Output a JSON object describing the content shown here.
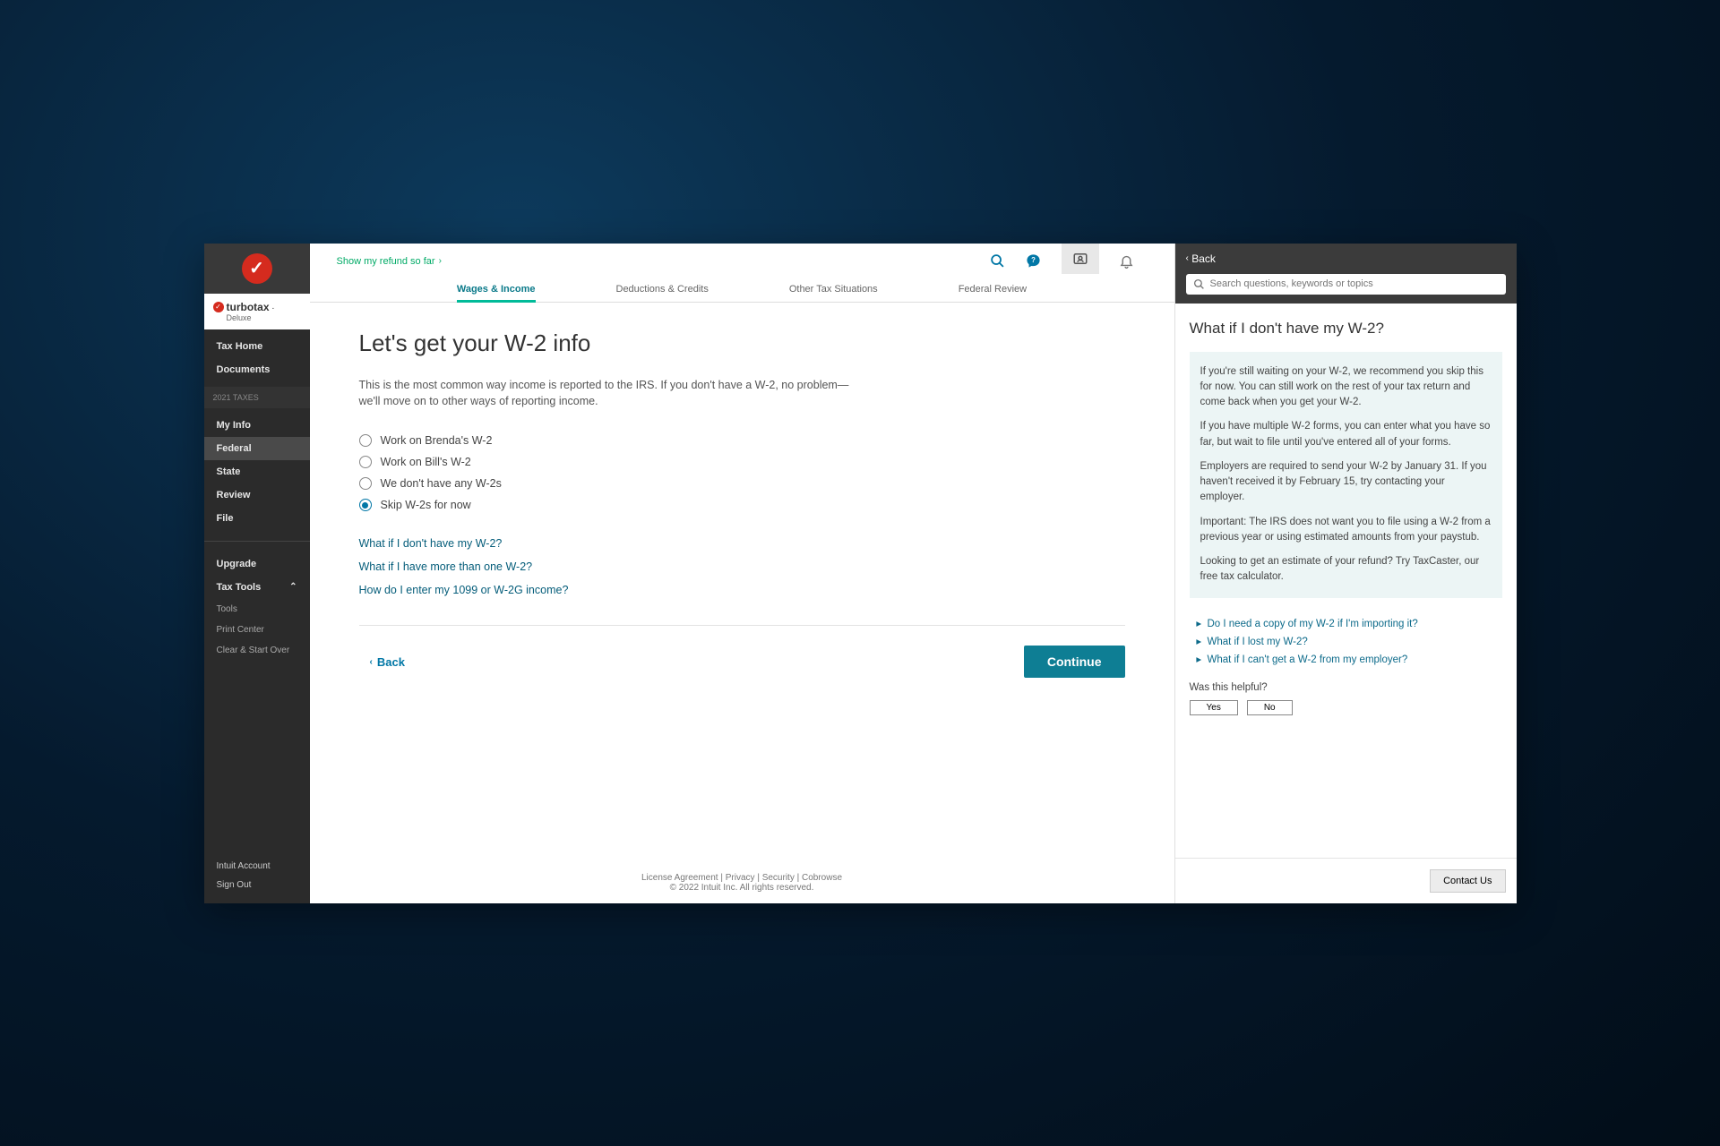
{
  "brand": {
    "name": "turbotax",
    "tier": "Deluxe"
  },
  "sidebar": {
    "items": [
      "Tax Home",
      "Documents"
    ],
    "taxes_header": "2021 TAXES",
    "tax_items": [
      "My Info",
      "Federal",
      "State",
      "Review",
      "File"
    ],
    "tools": {
      "upgrade": "Upgrade",
      "tax_tools": "Tax Tools",
      "subs": [
        "Tools",
        "Print Center",
        "Clear & Start Over"
      ]
    },
    "footer": {
      "account": "Intuit Account",
      "signout": "Sign Out"
    }
  },
  "topbar": {
    "refund_link": "Show my refund so far"
  },
  "tabs": [
    "Wages & Income",
    "Deductions & Credits",
    "Other Tax Situations",
    "Federal Review"
  ],
  "page": {
    "title": "Let's get your W-2 info",
    "desc": "This is the most common way income is reported to the IRS. If you don't have a W-2, no problem—we'll move on to other ways of reporting income.",
    "options": [
      "Work on Brenda's W-2",
      "Work on Bill's W-2",
      "We don't have any W-2s",
      "Skip W-2s for now"
    ],
    "selected_index": 3,
    "help_links": [
      "What if I don't have my W-2?",
      "What if I have more than one W-2?",
      "How do I enter my 1099 or W-2G income?"
    ],
    "back": "Back",
    "continue": "Continue"
  },
  "footer": {
    "links": [
      "License Agreement",
      "Privacy",
      "Security",
      "Cobrowse"
    ],
    "copyright": "© 2022 Intuit Inc. All rights reserved."
  },
  "help": {
    "back": "Back",
    "search_placeholder": "Search questions, keywords or topics",
    "title": "What if I don't have my W-2?",
    "paras": [
      "If you're still waiting on your W-2, we recommend you skip this for now. You can still work on the rest of your tax return and come back when you get your W-2.",
      "If you have multiple W-2 forms, you can enter what you have so far, but wait to file until you've entered all of your forms.",
      "Employers are required to send your W-2 by January 31. If you haven't received it by February 15, try contacting your employer.",
      "Important: The IRS does not want you to file using a W-2 from a previous year or using estimated amounts from your paystub.",
      "Looking to get an estimate of your refund? Try TaxCaster, our free tax calculator."
    ],
    "related": [
      "Do I need a copy of my W-2 if I'm importing it?",
      "What if I lost my W-2?",
      "What if I can't get a W-2 from my employer?"
    ],
    "helpful_q": "Was this helpful?",
    "yes": "Yes",
    "no": "No",
    "contact": "Contact Us"
  }
}
